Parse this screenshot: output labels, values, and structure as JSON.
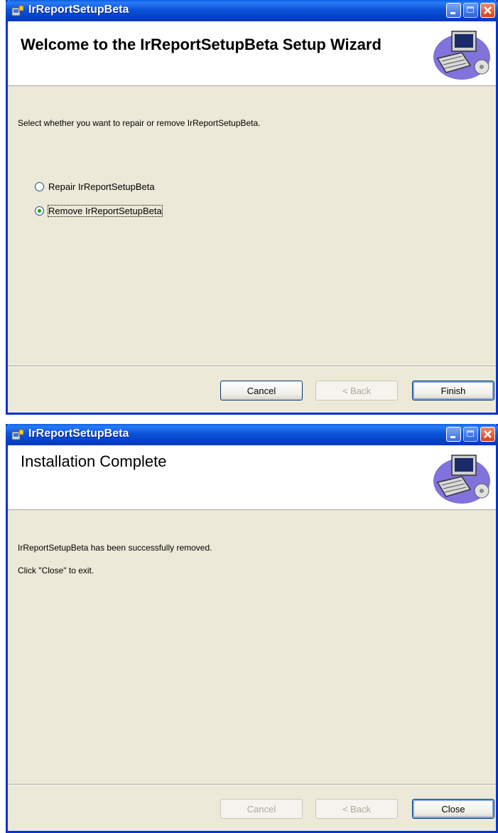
{
  "windows": [
    {
      "title": "IrReportSetupBeta",
      "banner_title": "Welcome to the IrReportSetupBeta Setup Wizard",
      "instruction": "Select whether you want to repair or remove IrReportSetupBeta.",
      "options": [
        {
          "label": "Repair IrReportSetupBeta",
          "selected": false
        },
        {
          "label": "Remove IrReportSetupBeta",
          "selected": true
        }
      ],
      "buttons": {
        "cancel": "Cancel",
        "back": "< Back",
        "next": "Finish"
      }
    },
    {
      "title": "IrReportSetupBeta",
      "banner_title": "Installation Complete",
      "message": "IrReportSetupBeta has been successfully removed.",
      "hint": "Click \"Close\" to exit.",
      "buttons": {
        "cancel": "Cancel",
        "back": "< Back",
        "next": "Close"
      }
    }
  ],
  "icons": {
    "app": "installer-icon",
    "banner": "computer-setup-icon"
  }
}
